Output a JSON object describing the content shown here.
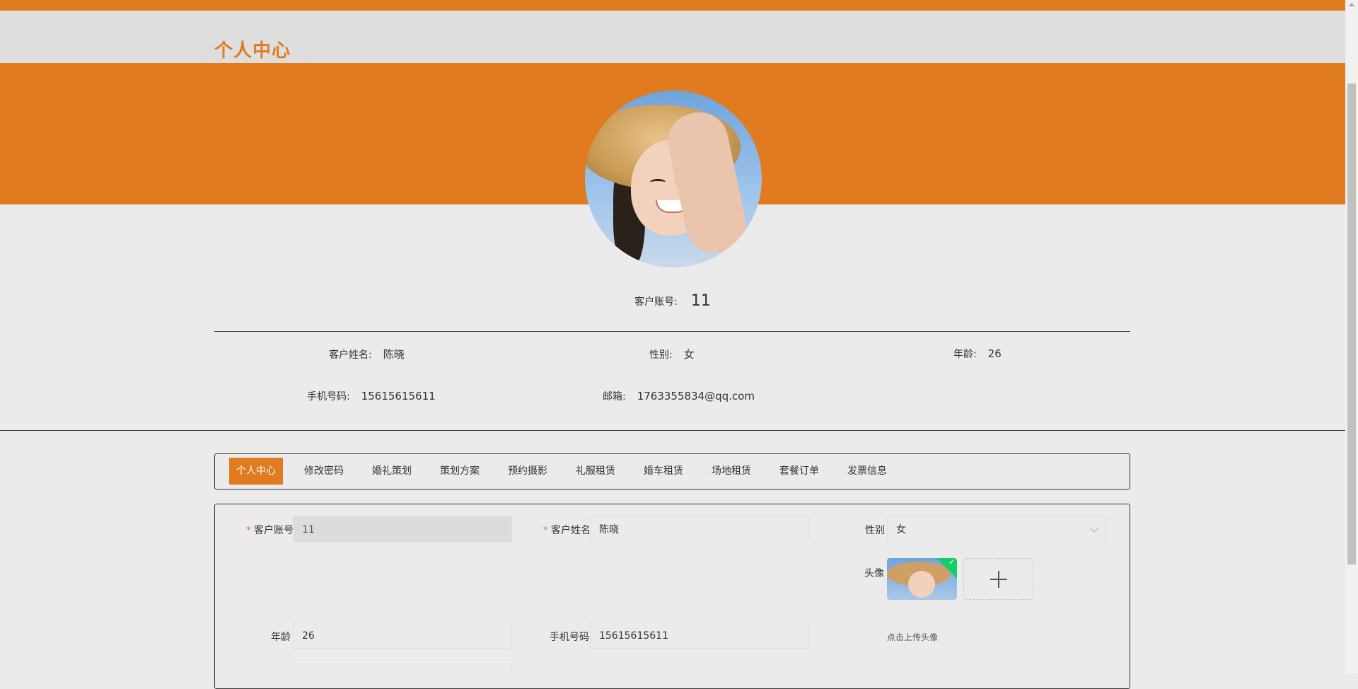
{
  "header": {
    "title": "个人中心"
  },
  "profile": {
    "account_label": "客户账号:",
    "account_value": "11",
    "name_label": "客户姓名:",
    "name_value": "陈晓",
    "gender_label": "性别:",
    "gender_value": "女",
    "age_label": "年龄:",
    "age_value": "26",
    "phone_label": "手机号码:",
    "phone_value": "15615615611",
    "email_label": "邮箱:",
    "email_value": "1763355834@qq.com"
  },
  "tabs": [
    {
      "label": "个人中心",
      "active": true
    },
    {
      "label": "修改密码"
    },
    {
      "label": "婚礼策划"
    },
    {
      "label": "策划方案"
    },
    {
      "label": "预约摄影"
    },
    {
      "label": "礼服租赁"
    },
    {
      "label": "婚车租赁"
    },
    {
      "label": "场地租赁"
    },
    {
      "label": "套餐订单"
    },
    {
      "label": "发票信息"
    }
  ],
  "form": {
    "required_mark": "*",
    "account_label": "客户账号",
    "account_value": "11",
    "name_label": "客户姓名",
    "name_value": "陈晓",
    "gender_label": "性别",
    "gender_value": "女",
    "avatar_label": "头像",
    "age_label": "年龄",
    "age_value": "26",
    "phone_label": "手机号码",
    "phone_value": "15615615611",
    "upload_hint": "点击上传头像",
    "upload_status_icon": "check-icon",
    "add_icon": "plus-icon"
  },
  "colors": {
    "accent": "#e07b20",
    "background": "#ebebeb",
    "header_bg": "#dedede",
    "success": "#13ce66",
    "required": "#f56c6c"
  }
}
